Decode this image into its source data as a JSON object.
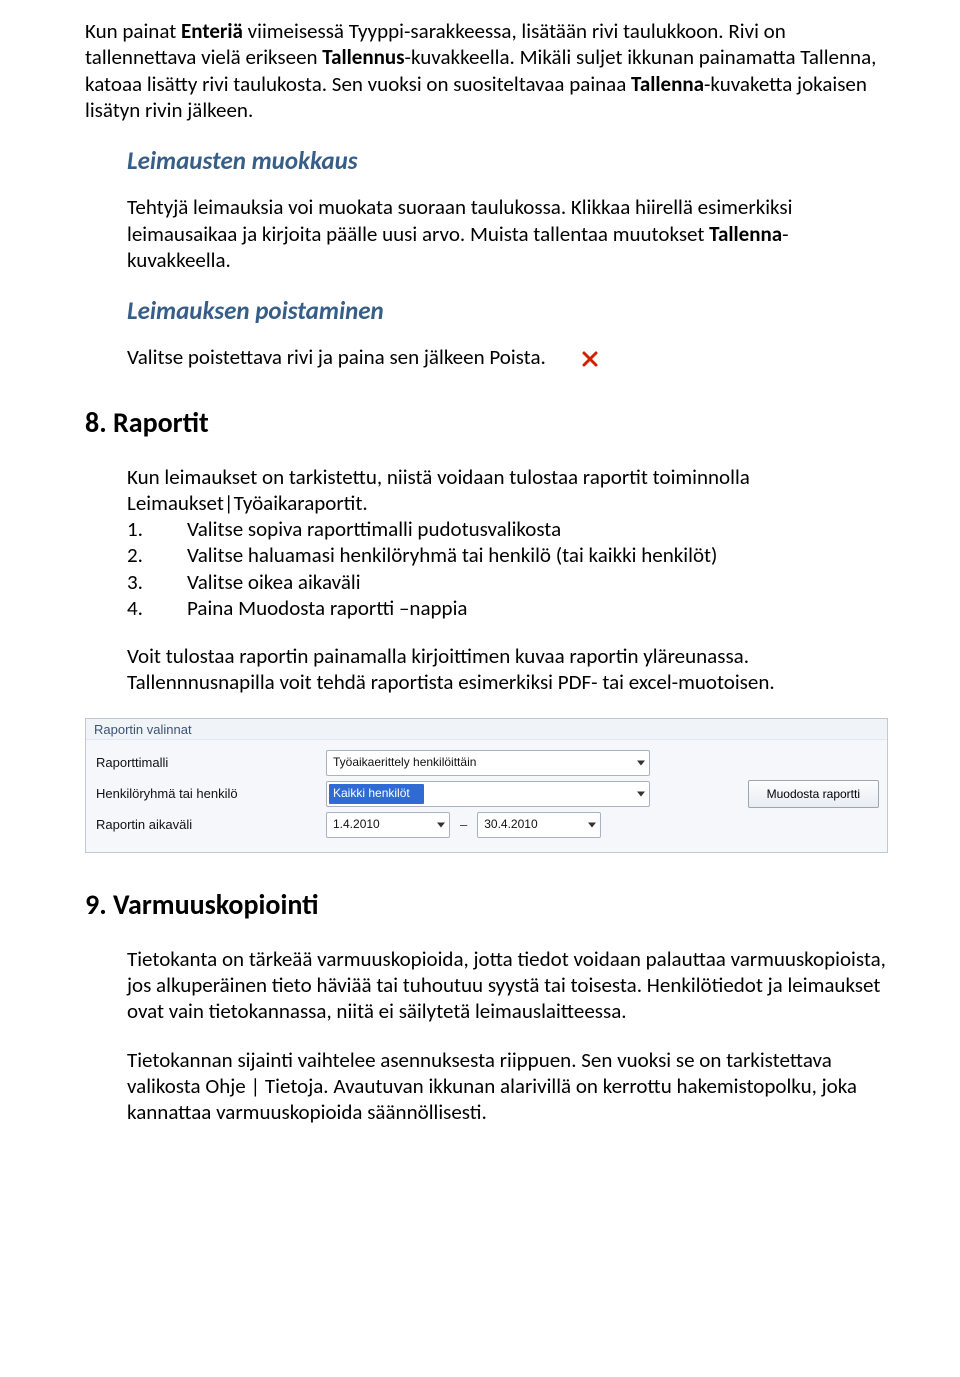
{
  "intro": {
    "p1_a": "Kun painat ",
    "p1_b": "Enteriä",
    "p1_c": " viimeisessä Tyyppi-sarakkeessa, lisätään rivi taulukkoon. Rivi on tallennettava vielä erikseen ",
    "p1_d": "Tallennus",
    "p1_e": "-kuvakkeella. Mikäli suljet ikkunan painamatta Tallenna, katoaa lisätty rivi taulukosta. Sen vuoksi on suositeltavaa painaa ",
    "p1_f": "Tallenna",
    "p1_g": "-kuvaketta jokaisen lisätyn rivin jälkeen."
  },
  "sec_edit": {
    "title": "Leimausten muokkaus",
    "p1_a": "Tehtyjä leimauksia voi muokata suoraan taulukossa. Klikkaa hiirellä esimerkiksi leimausaikaa ja kirjoita päälle uusi arvo. Muista tallentaa muutokset ",
    "p1_b": "Tallenna",
    "p1_c": "-kuvakkeella."
  },
  "sec_delete": {
    "title": "Leimauksen poistaminen",
    "p1": "Valitse poistettava rivi ja paina sen jälkeen Poista."
  },
  "sec_reports": {
    "title": "8. Raportit",
    "p1": "Kun leimaukset on tarkistettu, niistä voidaan tulostaa raportit toiminnolla Leimaukset|Työaikaraportit.",
    "steps": [
      {
        "n": "1.",
        "t": "Valitse sopiva raporttimalli pudotusvalikosta"
      },
      {
        "n": "2.",
        "t": "Valitse haluamasi henkilöryhmä tai henkilö (tai kaikki henkilöt)"
      },
      {
        "n": "3.",
        "t": "Valitse oikea aikaväli"
      },
      {
        "n": "4.",
        "t": "Paina Muodosta raportti –nappia"
      }
    ],
    "p2": "Voit tulostaa raportin painamalla kirjoittimen kuvaa raportin yläreunassa. Tallennnusnapilla voit tehdä raportista esimerkiksi PDF- tai excel-muotoisen."
  },
  "panel": {
    "group_title": "Raportin valinnat",
    "rows": {
      "template": {
        "label": "Raporttimalli",
        "value": "Työaikaerittely henkilöittäin"
      },
      "person": {
        "label": "Henkilöryhmä tai henkilö",
        "value": "Kaikki henkilöt"
      },
      "range": {
        "label": "Raportin aikaväli",
        "from": "1.4.2010",
        "to": "30.4.2010"
      }
    },
    "button": "Muodosta raportti"
  },
  "sec_backup": {
    "title": "9. Varmuuskopiointi",
    "p1": "Tietokanta on tärkeää varmuuskopioida, jotta tiedot voidaan palauttaa varmuuskopioista, jos alkuperäinen tieto häviää tai tuhoutuu syystä tai toisesta. Henkilötiedot ja leimaukset ovat vain tietokannassa, niitä ei säilytetä leimauslaitteessa.",
    "p2": "Tietokannan sijainti vaihtelee asennuksesta riippuen. Sen vuoksi se on tarkistettava valikosta Ohje | Tietoja. Avautuvan ikkunan alarivillä on kerrottu hakemistopolku, joka kannattaa varmuuskopioida säännöllisesti."
  }
}
